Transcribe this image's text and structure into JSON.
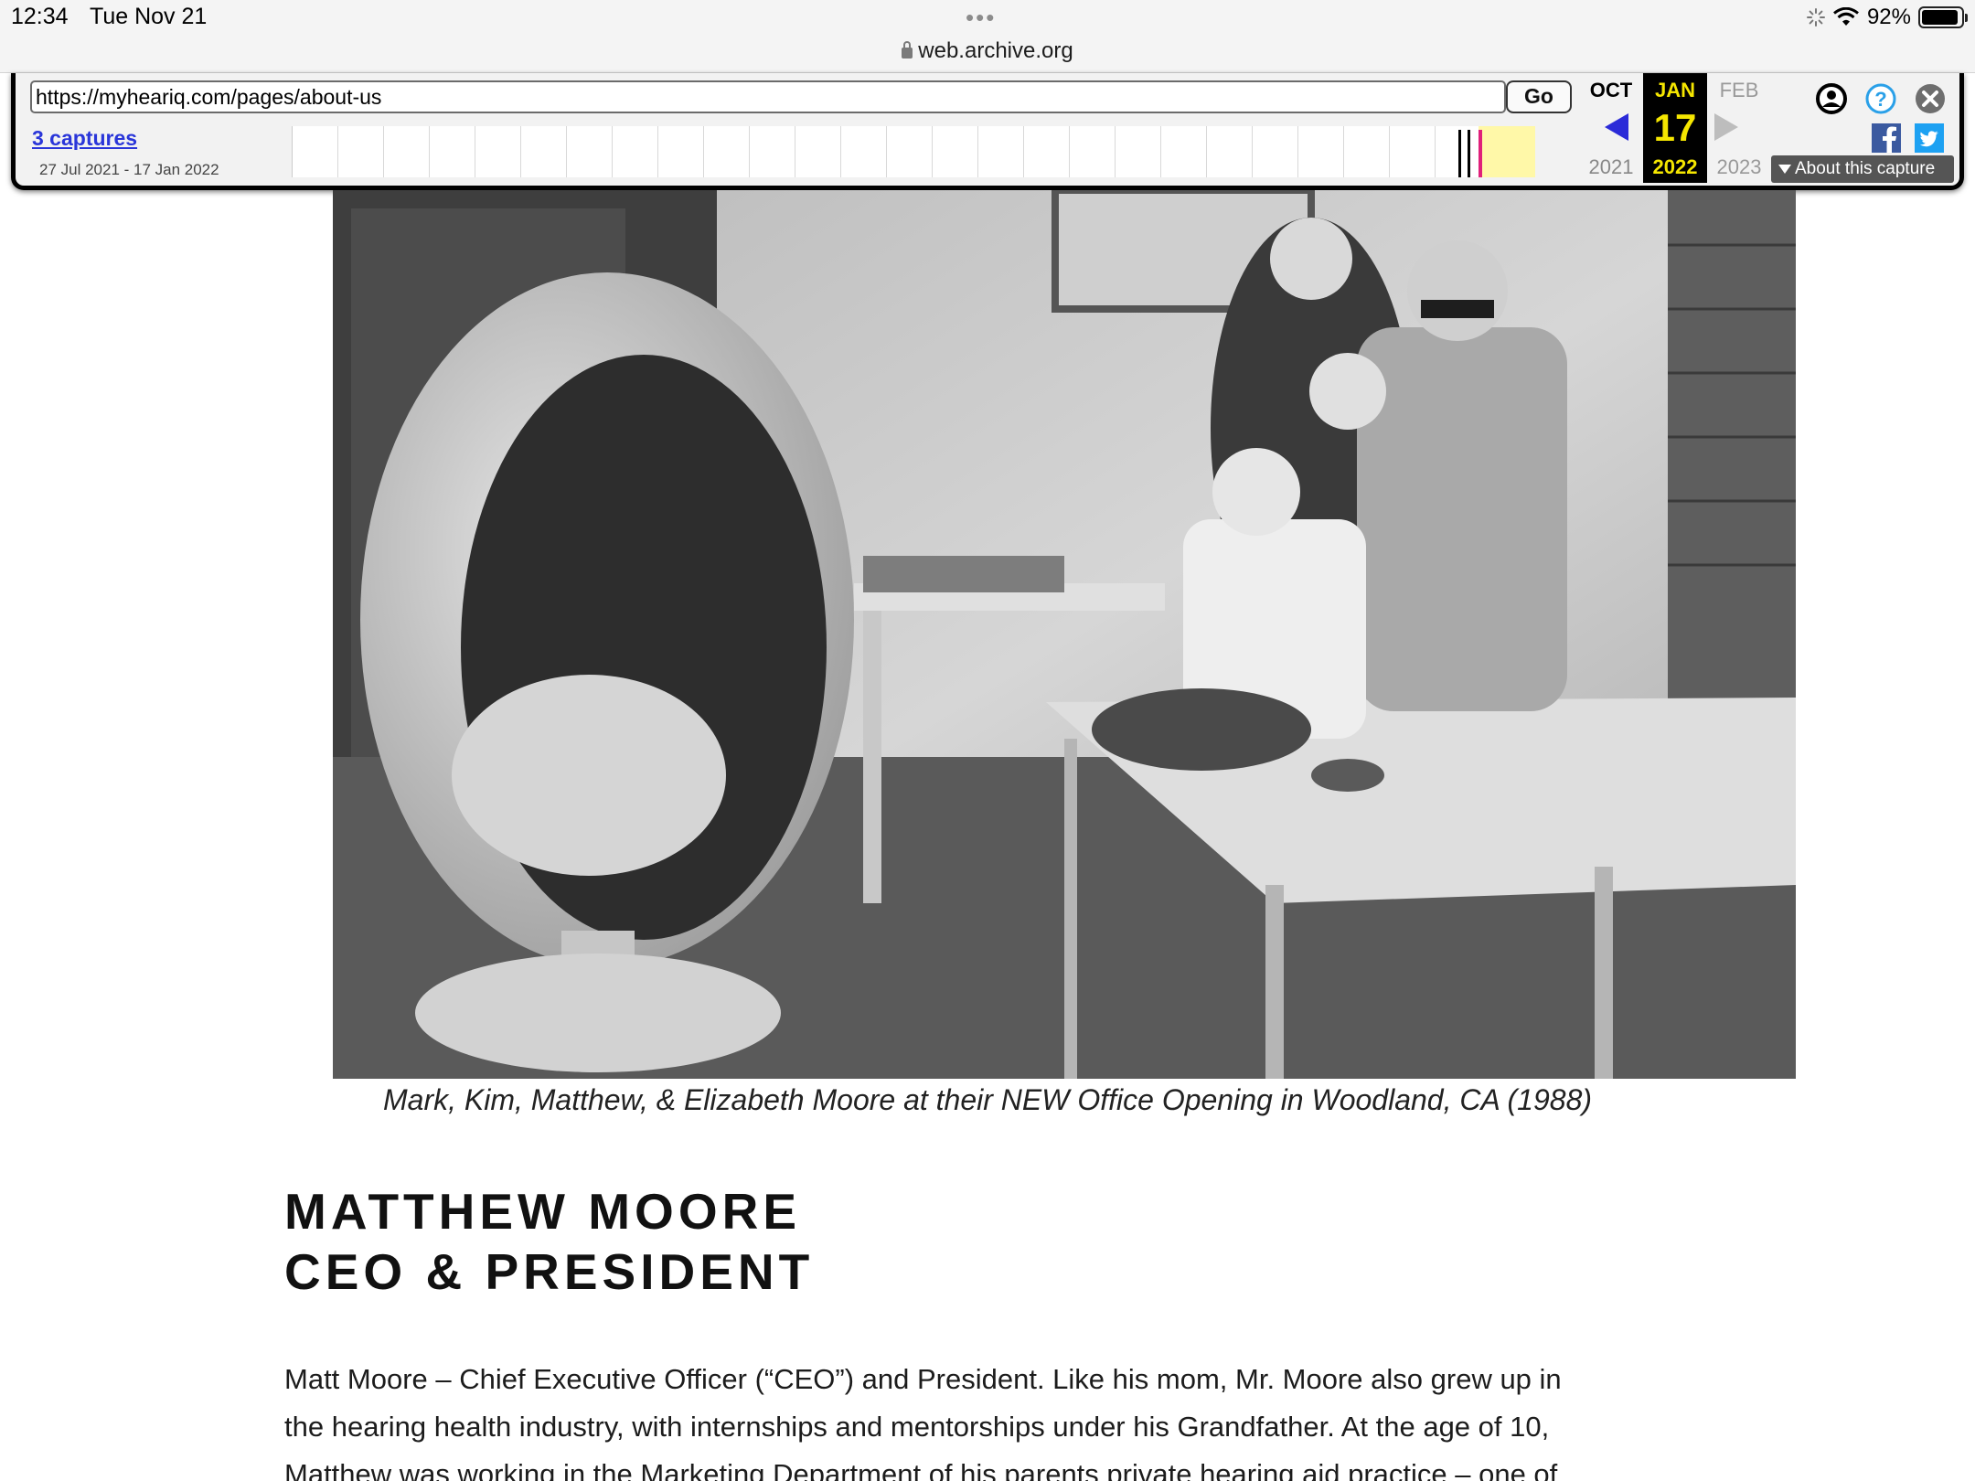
{
  "status_bar": {
    "time": "12:34",
    "date": "Tue Nov 21",
    "dots": "•••",
    "battery": "92%",
    "battery_level": 0.92
  },
  "safari": {
    "url": "web.archive.org"
  },
  "wayback": {
    "url": "https://myheariq.com/pages/about-us",
    "go_label": "Go",
    "captures_label": "3 captures",
    "range": "27 Jul 2021 - 17 Jan 2022",
    "prev_month": "OCT",
    "prev_year": "2021",
    "cur_month": "JAN",
    "cur_day": "17",
    "cur_year": "2022",
    "next_month": "FEB",
    "next_year": "2023",
    "about_label": "About this capture"
  },
  "caption": "Mark, Kim, Matthew, & Elizabeth Moore at their NEW Office Opening in Woodland, CA (1988)",
  "heading": {
    "line1": "MATTHEW MOORE",
    "line2": "CEO & PRESIDENT"
  },
  "paragraph": {
    "line1": "Matt Moore – Chief Executive Officer (“CEO”) and President.  Like his mom, Mr. Moore also grew up in",
    "line2": "the hearing health industry, with internships and mentorships under his Grandfather. At the age of 10,",
    "line3": "Matthew was working in the Marketing Department of his parents private hearing aid practice – one of"
  }
}
